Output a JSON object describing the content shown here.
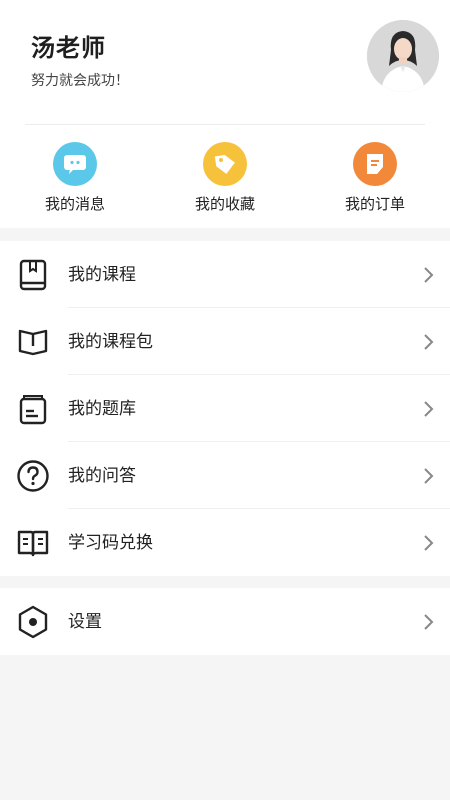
{
  "profile": {
    "name": "汤老师",
    "motto": "努力就会成功！"
  },
  "quick_actions": [
    {
      "label": "我的消息",
      "icon": "message-icon",
      "color": "#5bc4e6"
    },
    {
      "label": "我的收藏",
      "icon": "tag-icon",
      "color": "#f7c23b"
    },
    {
      "label": "我的订单",
      "icon": "order-icon",
      "color": "#f08a3c"
    }
  ],
  "menu": [
    {
      "label": "我的课程",
      "icon": "course-book-icon"
    },
    {
      "label": "我的课程包",
      "icon": "open-book-icon"
    },
    {
      "label": "我的题库",
      "icon": "question-bank-icon"
    },
    {
      "label": "我的问答",
      "icon": "question-circle-icon"
    },
    {
      "label": "学习码兑换",
      "icon": "reader-icon"
    }
  ],
  "settings": {
    "label": "设置",
    "icon": "hexagon-settings-icon"
  }
}
